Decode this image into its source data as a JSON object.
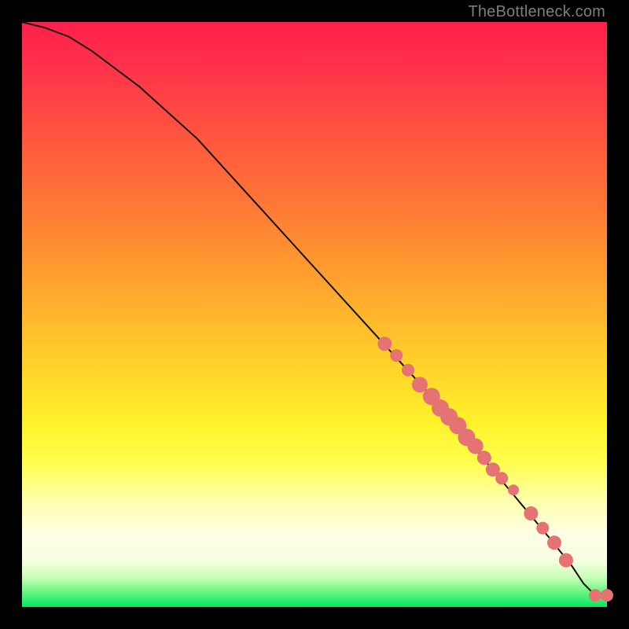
{
  "watermark": "TheBottleneck.com",
  "chart_data": {
    "type": "line",
    "title": "",
    "xlabel": "",
    "ylabel": "",
    "xlim": [
      0,
      100
    ],
    "ylim": [
      0,
      100
    ],
    "grid": false,
    "legend": false,
    "series": [
      {
        "name": "curve",
        "kind": "line",
        "x": [
          0,
          4,
          8,
          12,
          16,
          20,
          30,
          40,
          50,
          60,
          70,
          80,
          90,
          94,
          96,
          98,
          100
        ],
        "y": [
          100,
          99,
          97.5,
          95,
          92,
          89,
          80,
          69,
          58,
          47,
          36,
          24,
          12,
          7,
          4,
          2,
          2
        ]
      },
      {
        "name": "points",
        "kind": "scatter",
        "x": [
          62,
          64,
          66,
          68,
          70,
          71.5,
          73,
          74.5,
          76,
          77.5,
          79,
          80.5,
          82,
          84,
          87,
          89,
          91,
          93,
          98,
          100
        ],
        "y": [
          45,
          43,
          40.5,
          38,
          36,
          34,
          32.5,
          31,
          29,
          27.5,
          25.5,
          23.5,
          22,
          20,
          16,
          13.5,
          11,
          8,
          2,
          2
        ],
        "r": [
          9,
          8,
          8,
          10,
          11,
          11,
          11,
          11,
          11,
          10,
          9,
          9,
          8,
          7,
          9,
          8,
          9,
          9,
          8,
          8
        ]
      }
    ]
  }
}
